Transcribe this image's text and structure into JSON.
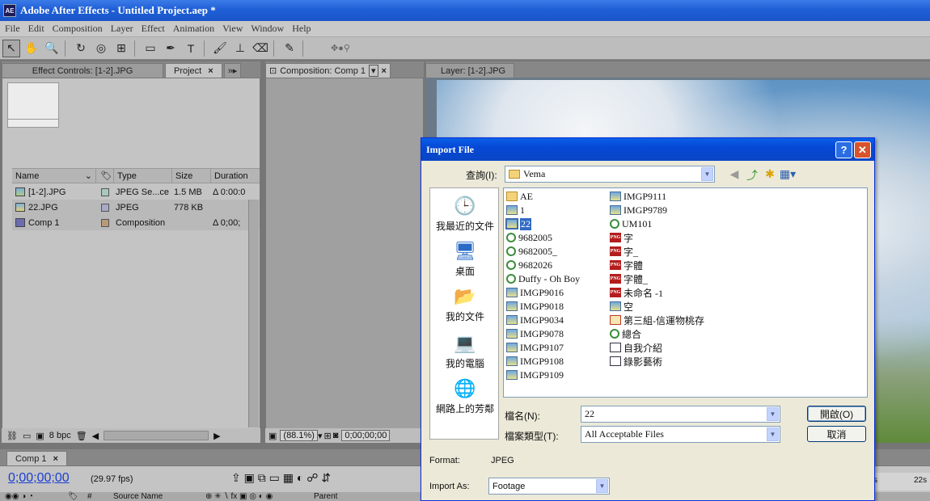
{
  "window": {
    "title": "Adobe After Effects - Untitled Project.aep *",
    "logo": "AE"
  },
  "menu": [
    "File",
    "Edit",
    "Composition",
    "Layer",
    "Effect",
    "Animation",
    "View",
    "Window",
    "Help"
  ],
  "toolbar_icons": [
    "selection-tool-icon",
    "hand-tool-icon",
    "zoom-tool-icon",
    "rotate-tool-icon",
    "orbit-camera-icon",
    "pan-behind-icon",
    "rectangle-mask-icon",
    "pen-tool-icon",
    "type-tool-icon",
    "brush-tool-icon",
    "clone-stamp-icon",
    "eraser-icon",
    "puppet-pin-icon",
    "axis-mode-icon"
  ],
  "panels": {
    "effect_controls_tab": "Effect Controls: [1-2].JPG",
    "project_tab": "Project",
    "composition_tab": "Composition: Comp 1",
    "layer_tab": "Layer: [1-2].JPG"
  },
  "project": {
    "columns": [
      "Name",
      "Type",
      "Size",
      "Duration"
    ],
    "rows": [
      {
        "name": "[1-2].JPG",
        "type": "JPEG Se...ce",
        "size": "1.5 MB",
        "duration": "Δ 0:00:0",
        "label_color": "#a8c8c0"
      },
      {
        "name": "22.JPG",
        "type": "JPEG",
        "size": "778 KB",
        "duration": "",
        "label_color": "#a8a8c8"
      },
      {
        "name": "Comp 1",
        "type": "Composition",
        "size": "",
        "duration": "Δ 0;00;",
        "label_color": "#b89a7a"
      }
    ],
    "bit_depth": "8 bpc"
  },
  "comp_footer": {
    "zoom": "(88.1%)",
    "timecode": "0;00;00;00"
  },
  "timeline": {
    "tab": "Comp 1",
    "timecode": "0;00;00;00",
    "fps": "(29.97 fps)",
    "source_name": "Source Name",
    "parent": "Parent",
    "ruler_label": "22s",
    "ruler_label_left": "s"
  },
  "dialog": {
    "title": "Import File",
    "help_btn": "?",
    "close_btn": "✕",
    "look_in_label": "查詢(I):",
    "look_in_value": "Vema",
    "places": [
      "我最近的文件",
      "桌面",
      "我的文件",
      "我的電腦",
      "網路上的芳鄰"
    ],
    "files_col1": [
      {
        "name": "AE",
        "icon": "folder"
      },
      {
        "name": "1",
        "icon": "img"
      },
      {
        "name": "22",
        "icon": "img",
        "selected": true
      },
      {
        "name": "9682005",
        "icon": "web"
      },
      {
        "name": "9682005_",
        "icon": "web"
      },
      {
        "name": "9682026",
        "icon": "web"
      },
      {
        "name": "Duffy - Oh Boy",
        "icon": "web"
      },
      {
        "name": "IMGP9016",
        "icon": "img"
      },
      {
        "name": "IMGP9018",
        "icon": "img"
      },
      {
        "name": "IMGP9034",
        "icon": "img"
      },
      {
        "name": "IMGP9078",
        "icon": "img"
      },
      {
        "name": "IMGP9107",
        "icon": "img"
      },
      {
        "name": "IMGP9108",
        "icon": "img"
      },
      {
        "name": "IMGP9109",
        "icon": "img"
      }
    ],
    "files_col2": [
      {
        "name": "IMGP9111",
        "icon": "img"
      },
      {
        "name": "IMGP9789",
        "icon": "img"
      },
      {
        "name": "UM101",
        "icon": "web"
      },
      {
        "name": "字",
        "icon": "png"
      },
      {
        "name": "字_",
        "icon": "png"
      },
      {
        "name": "字體",
        "icon": "png"
      },
      {
        "name": "字體_",
        "icon": "png"
      },
      {
        "name": "未命名 -1",
        "icon": "png"
      },
      {
        "name": "空",
        "icon": "img"
      },
      {
        "name": "第三組-信運物桃存",
        "icon": "pdf"
      },
      {
        "name": "總合",
        "icon": "web"
      },
      {
        "name": "自我介紹",
        "icon": "doc"
      },
      {
        "name": "錄影藝術",
        "icon": "doc"
      }
    ],
    "filename_label": "檔名(N):",
    "filename_value": "22",
    "filetype_label": "檔案類型(T):",
    "filetype_value": "All Acceptable Files",
    "open_button": "開啟(O)",
    "cancel_button": "取消",
    "format_label": "Format:",
    "format_value": "JPEG",
    "import_as_label": "Import As:",
    "import_as_value": "Footage"
  }
}
